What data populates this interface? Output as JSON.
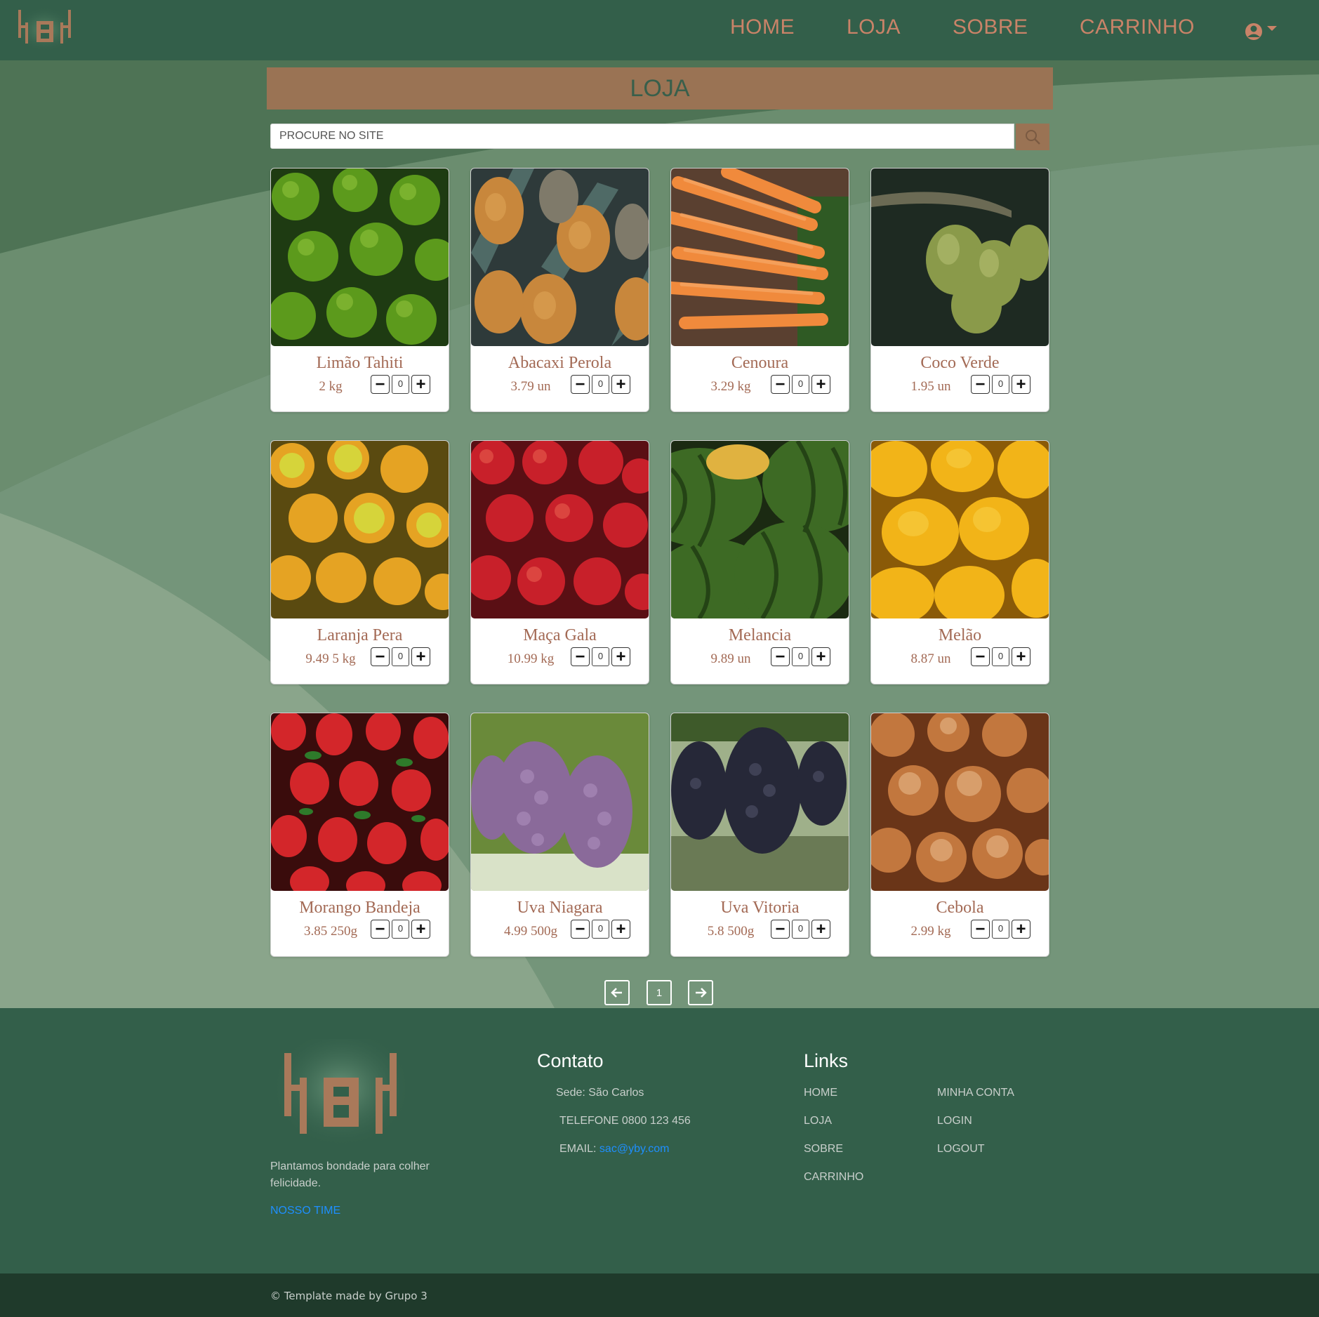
{
  "header": {
    "nav": [
      "HOME",
      "LOJA",
      "SOBRE",
      "CARRINHO"
    ]
  },
  "page": {
    "title": "LOJA"
  },
  "search": {
    "placeholder": "PROCURE NO SITE"
  },
  "products": [
    {
      "name": "Limão Tahiti",
      "price": "2 kg",
      "qty": "0",
      "image": "limes"
    },
    {
      "name": "Abacaxi Perola",
      "price": "3.79 un",
      "qty": "0",
      "image": "pineapples"
    },
    {
      "name": "Cenoura",
      "price": "3.29 kg",
      "qty": "0",
      "image": "carrots"
    },
    {
      "name": "Coco Verde",
      "price": "1.95 un",
      "qty": "0",
      "image": "coconuts"
    },
    {
      "name": "Laranja Pera",
      "price": "9.49 5 kg",
      "qty": "0",
      "image": "oranges"
    },
    {
      "name": "Maça Gala",
      "price": "10.99 kg",
      "qty": "0",
      "image": "apples"
    },
    {
      "name": "Melancia",
      "price": "9.89 un",
      "qty": "0",
      "image": "watermelons"
    },
    {
      "name": "Melão",
      "price": "8.87 un",
      "qty": "0",
      "image": "melons"
    },
    {
      "name": "Morango Bandeja",
      "price": "3.85 250g",
      "qty": "0",
      "image": "strawberries"
    },
    {
      "name": "Uva Niagara",
      "price": "4.99 500g",
      "qty": "0",
      "image": "purple-grapes"
    },
    {
      "name": "Uva Vitoria",
      "price": "5.8 500g",
      "qty": "0",
      "image": "black-grapes"
    },
    {
      "name": "Cebola",
      "price": "2.99 kg",
      "qty": "0",
      "image": "onions"
    }
  ],
  "pagination": {
    "current": "1"
  },
  "footer": {
    "tagline": "Plantamos bondade para colher felicidade.",
    "team_link": "NOSSO TIME",
    "contact": {
      "heading": "Contato",
      "address": "Sede: São Carlos",
      "phone": "TELEFONE 0800 123 456",
      "email_label": "EMAIL:",
      "email": "sac@yby.com"
    },
    "links": {
      "heading": "Links",
      "col1": [
        "HOME",
        "LOJA",
        "SOBRE",
        "CARRINHO"
      ],
      "col2": [
        "MINHA CONTA",
        "LOGIN",
        "LOGOUT"
      ]
    },
    "copyright": "© Template made by Grupo 3"
  },
  "colors": {
    "header_bg": "#335f4a",
    "accent_brown": "#9a7354",
    "nav_text": "#c98368",
    "body_green": "#4f7556",
    "link_blue": "#1e8fff"
  },
  "icons": {
    "logo": "yby-logo",
    "search": "search-icon",
    "user": "user-circle-icon",
    "caret": "caret-down-icon",
    "prev": "arrow-left-icon",
    "next": "arrow-right-icon"
  }
}
